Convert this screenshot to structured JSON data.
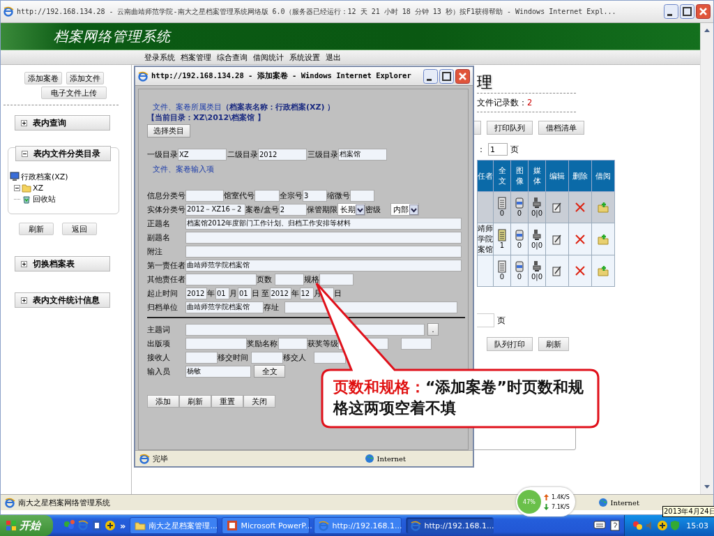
{
  "window": {
    "title": "http://192.168.134.28 - 云南曲靖师范学院-南大之星档案管理系统网络版 6.0（服务器已经运行：12 天 21 小时 18 分钟 13 秒）按F1获得帮助 - Windows Internet Expl..."
  },
  "header": {
    "title": "档案网络管理系统"
  },
  "menu": [
    "登录系统",
    "档案管理",
    "综合查询",
    "借阅统计",
    "系统设置",
    "退出"
  ],
  "sidebar": {
    "top_buttons": [
      "添加案卷",
      "添加文件",
      "电子文件上传"
    ],
    "panels": [
      {
        "title": "表内查询",
        "expanded": false
      },
      {
        "title": "表内文件分类目录",
        "expanded": true,
        "tree": [
          {
            "label": "行政档案(XZ)",
            "kind": "root",
            "children": [
              {
                "label": "XZ",
                "kind": "folder",
                "expanded": true
              },
              {
                "label": "回收站",
                "kind": "recycle"
              }
            ]
          }
        ],
        "buttons": [
          "刷新",
          "返回"
        ]
      },
      {
        "title": "切换档案表",
        "expanded": false
      },
      {
        "title": "表内文件统计信息",
        "expanded": false
      }
    ]
  },
  "main": {
    "heading": "理",
    "record_label": "文件记录数：",
    "record_count": "2",
    "toolbar_buttons": [
      "打印队列",
      "借档清单"
    ],
    "page_prefix": "：",
    "page_value": "1",
    "page_unit": "页",
    "table": {
      "columns": [
        "任者",
        "全文",
        "图像",
        "媒体",
        "编辑",
        "删除",
        "借阅"
      ],
      "rows": [
        {
          "column_1": "",
          "fulltext": "0",
          "image": "0",
          "media": "0|0",
          "selected": true
        },
        {
          "column_1": "靖师学院案馆",
          "fulltext": "1",
          "image": "0",
          "media": "0|0",
          "selected": false
        },
        {
          "column_1": "",
          "fulltext": "0",
          "image": "0",
          "media": "0|0",
          "selected": false
        }
      ]
    },
    "bottom_page_unit": "页",
    "bottom_buttons": [
      "队列打印",
      "刷新"
    ]
  },
  "popup": {
    "title": "http://192.168.134.28 - 添加案卷 - Windows Internet Explorer",
    "section_1": "文件、案卷所属类目**（档案表名称：行政档案(XZ) ）**",
    "current_dir": "【当前目录：XZ\\2012\\档案馆 】",
    "select_button": "选择类目",
    "levels": [
      {
        "label": "一级目录",
        "value": "XZ"
      },
      {
        "label": "二级目录",
        "value": "2012"
      },
      {
        "label": "三级目录",
        "value": "档案馆"
      }
    ],
    "section_2": "文件、案卷输入项",
    "rows": [
      {
        "items": [
          {
            "kind": "text",
            "label": "信息分类号"
          },
          {
            "kind": "text",
            "label": "馆室代号"
          },
          {
            "kind": "text",
            "label": "全宗号",
            "value": "3"
          },
          {
            "kind": "text",
            "label": "缩微号"
          }
        ]
      },
      {
        "items": [
          {
            "kind": "text",
            "label": "实体分类号",
            "value": "2012－XZ16－2"
          },
          {
            "kind": "text",
            "label": "案卷/盒号",
            "value": "2"
          },
          {
            "kind": "select",
            "label": "保管期限",
            "value": "长期"
          },
          {
            "kind": "select",
            "label": "密级",
            "value": "内部"
          }
        ]
      },
      {
        "items": [
          {
            "kind": "text",
            "label": "正题名",
            "value": "档案馆2012年度部门工作计划、归档工作安排等材料"
          }
        ]
      },
      {
        "items": [
          {
            "kind": "text",
            "label": "副题名"
          }
        ]
      },
      {
        "items": [
          {
            "kind": "text",
            "label": "附注"
          }
        ]
      },
      {
        "items": [
          {
            "kind": "text",
            "label": "第一责任者",
            "value": "曲靖师范学院档案馆"
          }
        ]
      },
      {
        "items": [
          {
            "kind": "text",
            "label": "其他责任者"
          },
          {
            "kind": "text",
            "label": "页数"
          },
          {
            "kind": "text",
            "label": "规格"
          }
        ]
      },
      {
        "items": [
          {
            "kind": "text",
            "label": "起止时间",
            "value": "2012"
          },
          {
            "kind": "text",
            "label": "年",
            "value": "01"
          },
          {
            "kind": "text",
            "label": "月",
            "value": "01"
          },
          {
            "kind": "text",
            "label": "日 至",
            "value": "2012"
          },
          {
            "kind": "text",
            "label": "年",
            "value": "12"
          },
          {
            "kind": "text",
            "label": "月"
          },
          {
            "kind": "label",
            "label": "日"
          }
        ]
      },
      {
        "items": [
          {
            "kind": "text",
            "label": "归档单位",
            "value": "曲靖师范学院档案馆"
          },
          {
            "kind": "text",
            "label": "存址"
          }
        ]
      },
      {
        "items": [
          {
            "kind": "text",
            "label": "主题词"
          },
          {
            "kind": "button",
            "label": "."
          }
        ]
      },
      {
        "items": [
          {
            "kind": "text",
            "label": "出版项"
          },
          {
            "kind": "text",
            "label": "奖励名称"
          },
          {
            "kind": "text",
            "label": "获奖等级"
          },
          {
            "kind": "text"
          }
        ]
      },
      {
        "items": [
          {
            "kind": "text",
            "label": "接收人"
          },
          {
            "kind": "text",
            "label": "移交时间"
          },
          {
            "kind": "text",
            "label": "移交人"
          }
        ]
      },
      {
        "items": [
          {
            "kind": "text",
            "label": "输入员",
            "value": "杨敏"
          },
          {
            "kind": "button",
            "label": "全文"
          }
        ]
      }
    ],
    "buttons": [
      "添加",
      "刷新",
      "重置",
      "关闭"
    ],
    "status": "完毕",
    "zone": "Internet"
  },
  "callout": {
    "label": "页数和规格：",
    "text": "“添加案卷”时页数和规格这两项空着不填"
  },
  "status_bar": {
    "text": "南大之星档案网络管理系统",
    "zone": "Internet"
  },
  "net_widget": {
    "percent": "47%",
    "up": "1.4K/S",
    "down": "7.1K/S"
  },
  "date_tooltip": "2013年4月24日",
  "taskbar": {
    "start": "开始",
    "more": "»",
    "tasks": [
      {
        "label": "南大之星档案管理...",
        "kind": "folder",
        "selected": false
      },
      {
        "label": "Microsoft PowerP...",
        "kind": "powerpoint",
        "selected": false
      },
      {
        "label": "http://192.168.1...",
        "kind": "browser",
        "selected": false
      },
      {
        "label": "http://192.168.1...",
        "kind": "browser",
        "selected": true
      }
    ],
    "clock": "15:03"
  }
}
